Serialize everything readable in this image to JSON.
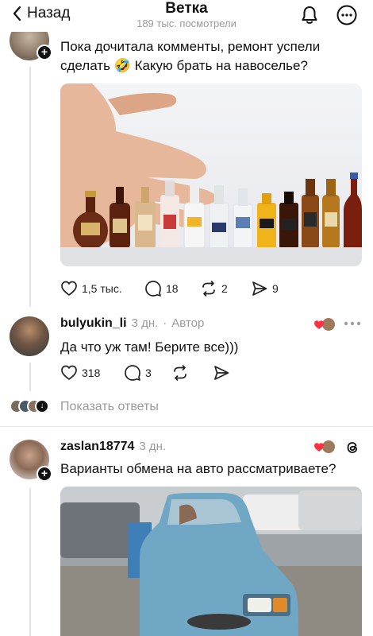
{
  "header": {
    "back_label": "Назад",
    "title": "Ветка",
    "subtitle": "189 тыс. посмотрели"
  },
  "post": {
    "text": "Пока дочитала комменты, ремонт успели сделать 🤣 Какую брать на навоселье?",
    "image_icon": "mini-bottles-photo",
    "likes": "1,5 тыс.",
    "comments": "18",
    "reposts": "2",
    "shares": "9"
  },
  "reply1": {
    "username": "bulyukin_li",
    "time": "3 дн.",
    "role": "Автор",
    "text": "Да что уж там! Берите все)))",
    "likes": "318",
    "comments": "3",
    "show_replies": "Показать ответы"
  },
  "reply2": {
    "username": "zaslan18774",
    "time": "3 дн.",
    "text": "Варианты обмена на авто рассматриваете?",
    "image_icon": "car-photo"
  },
  "colors": {
    "accent_red": "#ff3040",
    "muted": "#9a9a9a",
    "line": "#e2e2e2"
  }
}
